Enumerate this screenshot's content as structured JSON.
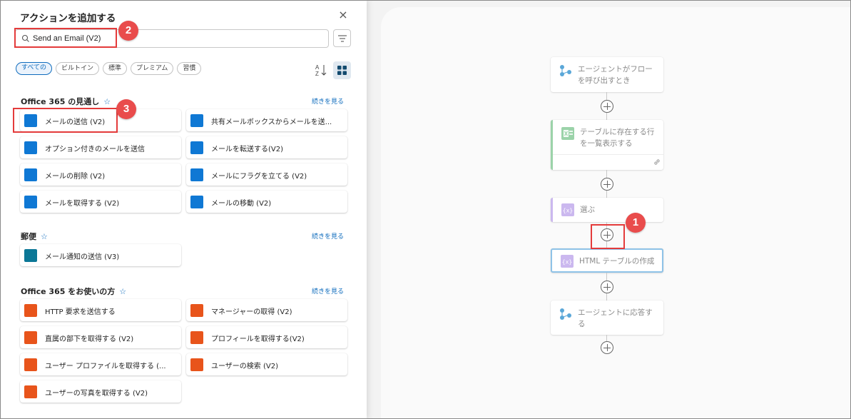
{
  "panel": {
    "title": "アクションを追加する",
    "close_label": "×",
    "search_value": "Send an Email (V2)",
    "filter_chips": [
      "すべての",
      "ビルトイン",
      "標準",
      "プレミアム",
      "習慣"
    ],
    "sort_label": "A Z"
  },
  "sections": [
    {
      "title": "Office 365 の見通し",
      "see_more": "続きを見る",
      "actions": [
        {
          "label": "メールの送信 (V2)",
          "icon": "outlook-icon"
        },
        {
          "label": "共有メールボックスからメールを送...",
          "icon": "outlook-icon"
        },
        {
          "label": "オプション付きのメールを送信",
          "icon": "outlook-icon"
        },
        {
          "label": "メールを転送する(V2)",
          "icon": "outlook-icon"
        },
        {
          "label": "メールの削除 (V2)",
          "icon": "outlook-icon"
        },
        {
          "label": "メールにフラグを立てる (V2)",
          "icon": "outlook-icon"
        },
        {
          "label": "メールを取得する (V2)",
          "icon": "outlook-icon"
        },
        {
          "label": "メールの移動 (V2)",
          "icon": "outlook-icon"
        }
      ]
    },
    {
      "title": "郵便",
      "see_more": "続きを見る",
      "actions": [
        {
          "label": "メール通知の送信 (V3)",
          "icon": "mail-icon"
        }
      ]
    },
    {
      "title": "Office 365 をお使いの方",
      "see_more": "続きを見る",
      "actions": [
        {
          "label": "HTTP 要求を送信する",
          "icon": "office-icon"
        },
        {
          "label": "マネージャーの取得 (V2)",
          "icon": "office-icon"
        },
        {
          "label": "直属の部下を取得する (V2)",
          "icon": "office-icon"
        },
        {
          "label": "プロフィールを取得する(V2)",
          "icon": "office-icon"
        },
        {
          "label": "ユーザー プロファイルを取得する (...",
          "icon": "office-icon"
        },
        {
          "label": "ユーザーの検索 (V2)",
          "icon": "office-icon"
        },
        {
          "label": "ユーザーの写真を取得する (V2)",
          "icon": "office-icon"
        }
      ]
    }
  ],
  "flow": {
    "nodes": [
      {
        "label": "エージェントがフローを呼び出すとき",
        "icon": "agent-icon"
      },
      {
        "label": "テーブルに存在する行を一覧表示する",
        "icon": "excel-icon"
      },
      {
        "label": "選ぶ",
        "icon": "expression-icon"
      },
      {
        "label": "HTML テーブルの作成",
        "icon": "expression-icon"
      },
      {
        "label": "エージェントに応答する",
        "icon": "agent-icon"
      }
    ]
  },
  "callouts": [
    "1",
    "2",
    "3"
  ],
  "colors": {
    "accent": "#0f6cbd",
    "callout_red": "#e94c4c",
    "outlook_blue": "#0f78d4",
    "office_orange": "#e8541b",
    "excel_green": "#9bd3a9"
  }
}
